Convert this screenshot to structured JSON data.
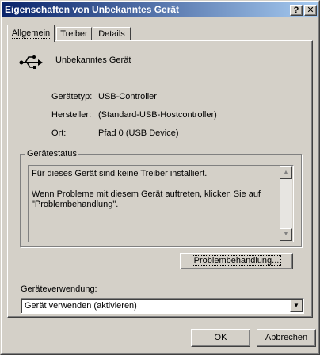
{
  "window": {
    "title": "Eigenschaften von Unbekanntes Gerät",
    "help_glyph": "?",
    "close_glyph": "✕"
  },
  "tabs": [
    {
      "label": "Allgemein",
      "active": true
    },
    {
      "label": "Treiber",
      "active": false
    },
    {
      "label": "Details",
      "active": false
    }
  ],
  "device": {
    "icon": "usb-icon",
    "name": "Unbekanntes Gerät"
  },
  "properties": [
    {
      "label": "Gerätetyp:",
      "value": "USB-Controller"
    },
    {
      "label": "Hersteller:",
      "value": "(Standard-USB-Hostcontroller)"
    },
    {
      "label": "Ort:",
      "value": "Pfad 0 (USB Device)"
    }
  ],
  "status": {
    "group_title": "Gerätestatus",
    "text": "Für dieses Gerät sind keine Treiber installiert.\n\nWenn Probleme mit diesem Gerät auftreten, klicken Sie auf \"Problembehandlung\".",
    "troubleshoot_label": "Problembehandlung..."
  },
  "usage": {
    "label": "Geräteverwendung:",
    "selected": "Gerät verwenden (aktivieren)"
  },
  "footer": {
    "ok_label": "OK",
    "cancel_label": "Abbrechen"
  },
  "colors": {
    "title_start": "#0a246a",
    "title_end": "#a6caf0",
    "face": "#d4d0c8"
  }
}
